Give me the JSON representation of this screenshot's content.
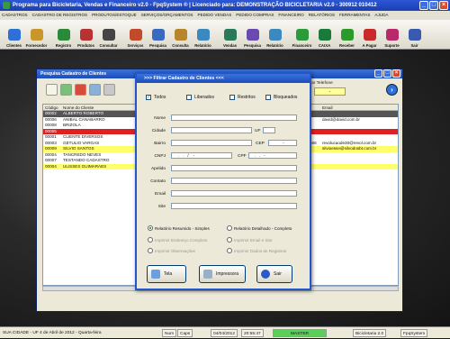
{
  "app": {
    "title": "Programa para Bicicletaria, Vendas e Financeiro v2.0 - FpqSystem ® | Licenciado para: DEMONSTRAÇÃO BICICLETARIA v2.0 - 300912 010412",
    "min": "_",
    "max": "□",
    "close": "×"
  },
  "menu": [
    "CADASTROS",
    "CADASTRO DE REGISTROS",
    "PRODUTOS/ESTOQUE",
    "SERVIÇOS/ORÇAMENTOS",
    "PEDIDO VENDAS",
    "PEDIDO COMPRAS",
    "FINANCEIRO",
    "RELATÓRIOS",
    "FERRAMENTAS",
    "AJUDA"
  ],
  "toolbar": [
    {
      "label": "Clientes",
      "icon": "clients-icon",
      "color": "#2f6fd8"
    },
    {
      "label": "Fornecedor",
      "icon": "supplier-icon",
      "color": "#c8962a"
    },
    {
      "sep": true
    },
    {
      "label": "Registro",
      "icon": "bicycle-icon",
      "color": "#2a8a3a"
    },
    {
      "label": "Produtos",
      "icon": "products-icon",
      "color": "#b83232"
    },
    {
      "label": "Consultar",
      "icon": "consult-icon",
      "color": "#444"
    },
    {
      "sep": true
    },
    {
      "label": "Serviços",
      "icon": "services-icon",
      "color": "#c04a2a"
    },
    {
      "label": "Pesquisa",
      "icon": "search-icon",
      "color": "#3a6ac0"
    },
    {
      "label": "Consulta",
      "icon": "consult-icon",
      "color": "#b8862a"
    },
    {
      "label": "Relatório",
      "icon": "report-icon",
      "color": "#3a8ac0"
    },
    {
      "sep": true
    },
    {
      "label": "Vendas",
      "icon": "sales-icon",
      "color": "#2a7a5a"
    },
    {
      "label": "Pesquisa",
      "icon": "search-icon",
      "color": "#6a4ab0"
    },
    {
      "label": "Relatório",
      "icon": "report-icon",
      "color": "#3a8ac0"
    },
    {
      "sep": true
    },
    {
      "label": "Financeiro",
      "icon": "finance-icon",
      "color": "#2a9a3a"
    },
    {
      "label": "CAIXA",
      "icon": "cashier-icon",
      "color": "#1a7a3a"
    },
    {
      "label": "Receber",
      "icon": "receive-icon",
      "color": "#2a9a2a"
    },
    {
      "label": "A Pagar",
      "icon": "pay-icon",
      "color": "#c82a2a"
    },
    {
      "label": "Suporte",
      "icon": "support-icon",
      "color": "#b82a6a"
    },
    {
      "label": "Sair",
      "icon": "exit-icon",
      "color": "#3a5ab0"
    }
  ],
  "search_window": {
    "title": "Pesquisa Cadastro de Clientes",
    "col_code": "Código",
    "col_name": "Nome do Cliente",
    "col_email": "Email",
    "phone_label": "Rastrear Telefone",
    "phone_value": "-",
    "go": "›",
    "rows": [
      {
        "code": "00002",
        "name": "ALBERTO ROBERTO",
        "email": "",
        "bg": "#555",
        "color": "#fff"
      },
      {
        "code": "00006",
        "name": "ANIBAL CANABARRO",
        "email": "david@david.com.br",
        "bg": "#fff",
        "color": "#111"
      },
      {
        "code": "00008",
        "name": "BRIZOLA",
        "email": "",
        "bg": "#fff",
        "color": "#111"
      },
      {
        "code": "00005",
        "name": "",
        "email": "",
        "bg": "#e02020",
        "color": "#fff"
      },
      {
        "code": "00001",
        "name": "CLIENTE DIVERSOS",
        "email": "",
        "bg": "#fff",
        "color": "#111"
      },
      {
        "code": "00003",
        "name": "GETULIO VARGAS",
        "extra": "666",
        "email": "revolucaode30@revol.com.br",
        "bg": "#fff",
        "color": "#111"
      },
      {
        "code": "00009",
        "name": "SILVIO SANTOS",
        "email": "silvioesse@silvodosbt.com.br",
        "bg": "#ffff6a",
        "color": "#111"
      },
      {
        "code": "00004",
        "name": "TANCREDO NEVES",
        "email": "",
        "bg": "#fff",
        "color": "#111"
      },
      {
        "code": "00007",
        "name": "TESTANDO CADASTRO",
        "email": "",
        "bg": "#fff",
        "color": "#111"
      },
      {
        "code": "00004",
        "name": "ULISSES GUIMARAES",
        "email": "",
        "bg": "#ffff6a",
        "color": "#111"
      }
    ]
  },
  "filter": {
    "title": ">>> Filtrar Cadastro de Clientes <<<",
    "chk_all": "Todos",
    "chk_all_mark": "✓",
    "chk_released": "Liberados",
    "chk_restricted": "Restritos",
    "chk_blocked": "Bloqueados",
    "lbl_name": "Nome",
    "lbl_city": "Cidade",
    "lbl_uf": "UF",
    "lbl_district": "Bairro",
    "lbl_cep": "CEP",
    "cep_value": "-",
    "lbl_cnpj": "CNPJ",
    "cnpj_value": "    .   .   /    -",
    "lbl_cpf": "CPF",
    "cpf_value": "   .   .   -",
    "lbl_nick": "Apelido",
    "lbl_contact": "Contato",
    "lbl_email": "Email",
    "lbl_site": "Site",
    "r_simple": "Relatório Resumido - Simples",
    "r_detailed": "Relatório Detalhado - Completo",
    "opt_address": "Imprimir Endereço Completo",
    "opt_email": "Imprimir Email e Site",
    "opt_notes": "Imprimir Observações",
    "opt_records": "Imprimir Dados de Registros",
    "btn_screen": "Tela",
    "btn_print": "Impressora",
    "btn_exit": "Sair"
  },
  "status": {
    "city": "SUA CIDADE - UF  4 de Abril de 2012 - Quarta-feira",
    "num": "Num",
    "caps": "Caps",
    "date": "04/04/2012",
    "time": "20:55:47",
    "master": "MASTER",
    "app": "Bicicletaria 2.0",
    "brand": "FpqSystem"
  }
}
